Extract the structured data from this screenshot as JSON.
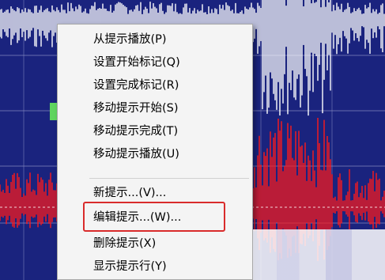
{
  "menu": {
    "items": [
      {
        "label": "从提示播放(P)"
      },
      {
        "label": "设置开始标记(Q)"
      },
      {
        "label": "设置完成标记(R)"
      },
      {
        "label": "移动提示开始(S)"
      },
      {
        "label": "移动提示完成(T)"
      },
      {
        "label": "移动提示播放(U)"
      },
      {
        "label": "新提示...(V)..."
      },
      {
        "label": "编辑提示...(W)..."
      },
      {
        "label": "删除提示(X)"
      },
      {
        "label": "显示提示行(Y)"
      }
    ]
  },
  "colors": {
    "waveform_background": "#1a237e",
    "upper_wave": "#ffffff",
    "lower_wave": "#ff1a1a",
    "highlight": "#d92b2b",
    "cue_marker": "#5fd45f"
  }
}
